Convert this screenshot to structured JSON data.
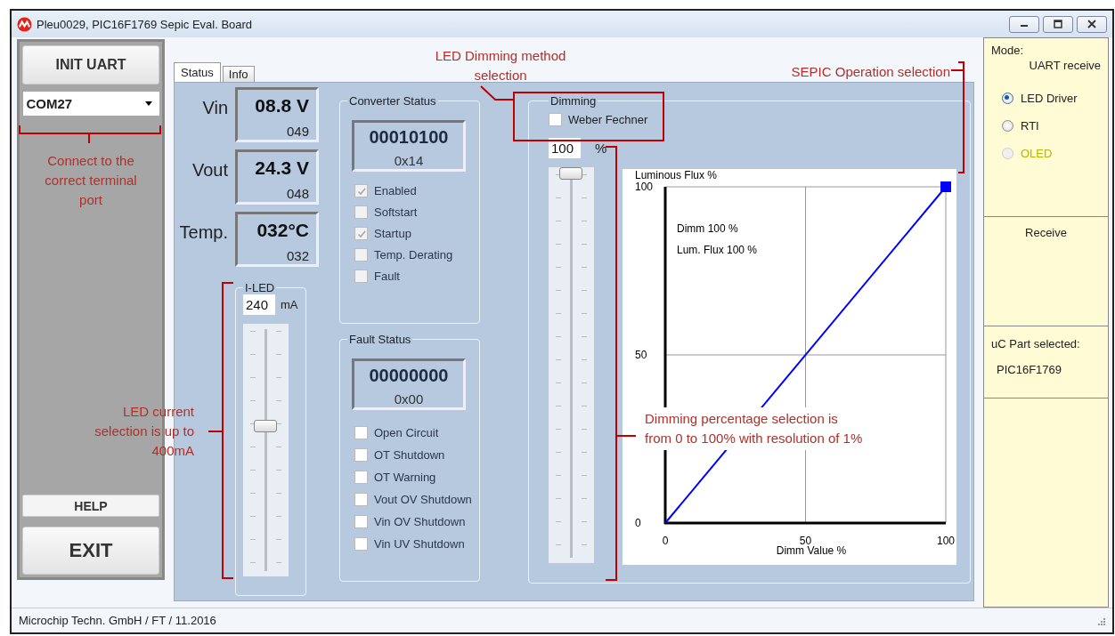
{
  "window": {
    "title": "Pleu0029, PIC16F1769 Sepic Eval. Board"
  },
  "left_panel": {
    "init_button": "INIT UART",
    "port_select": {
      "value": "COM27"
    },
    "help_button": "HELP",
    "exit_button": "EXIT"
  },
  "tabs": [
    {
      "label": "Status",
      "selected": true
    },
    {
      "label": "Info",
      "selected": false
    }
  ],
  "readouts": [
    {
      "label": "Vin",
      "value": "08.8 V",
      "raw": "049"
    },
    {
      "label": "Vout",
      "value": "24.3 V",
      "raw": "048"
    },
    {
      "label": "Temp.",
      "value": "032°C",
      "raw": "032"
    }
  ],
  "i_led": {
    "title": "I-LED",
    "value": "240",
    "unit": "mA",
    "level": 0.6
  },
  "converter_status": {
    "title": "Converter Status",
    "binary": "00010100",
    "hex": "0x14",
    "flags": [
      {
        "label": "Enabled",
        "checked": true
      },
      {
        "label": "Softstart",
        "checked": false
      },
      {
        "label": "Startup",
        "checked": true
      },
      {
        "label": "Temp. Derating",
        "checked": false
      },
      {
        "label": "Fault",
        "checked": false
      }
    ]
  },
  "fault_status": {
    "title": "Fault Status",
    "binary": "00000000",
    "hex": "0x00",
    "flags": [
      {
        "label": "Open Circuit",
        "checked": false
      },
      {
        "label": "OT Shutdown",
        "checked": false
      },
      {
        "label": "OT Warning",
        "checked": false
      },
      {
        "label": "Vout OV Shutdown",
        "checked": false
      },
      {
        "label": "Vin OV Shutdown",
        "checked": false
      },
      {
        "label": "Vin UV Shutdown",
        "checked": false
      }
    ]
  },
  "dimming": {
    "title": "Dimming",
    "weber_fechner": {
      "label": "Weber Fechner",
      "checked": false
    },
    "value": "100",
    "unit": "%",
    "level": 1,
    "chart_data": {
      "type": "line",
      "xlabel": "Dimm Value %",
      "ylabel": "Luminous Flux %",
      "x": [
        0,
        100
      ],
      "series": [
        {
          "color": "#0000ff",
          "values": [
            0,
            100
          ]
        }
      ],
      "xlim": [
        0,
        100
      ],
      "ylim": [
        0,
        100
      ],
      "xticks": [
        0,
        50,
        100
      ],
      "yticks": [
        0,
        50,
        100
      ],
      "annotations": [
        "Dimm 100 %",
        "Lum. Flux 100 %"
      ]
    }
  },
  "mode_panel": {
    "title": "Mode:",
    "status": "UART receive",
    "options": [
      {
        "label": "LED Driver",
        "selected": true,
        "disabled": false
      },
      {
        "label": "RTI",
        "selected": false,
        "disabled": false
      },
      {
        "label": "OLED",
        "selected": false,
        "disabled": true
      }
    ]
  },
  "receive_panel": {
    "label": "Receive"
  },
  "part_panel": {
    "title": "uC Part selected:",
    "value": "PIC16F1769"
  },
  "status_bar": "Microchip Techn. GmbH / FT / 11.2016",
  "annotations": [
    {
      "text": "LED Dimming method selection"
    },
    {
      "text": "SEPIC Operation selection"
    },
    {
      "text": "Connect to the correct terminal port"
    },
    {
      "text": "LED current selection is up to 400mA"
    },
    {
      "text": "Dimming percentage selection is from 0 to 100% with resolution of 1%"
    }
  ]
}
